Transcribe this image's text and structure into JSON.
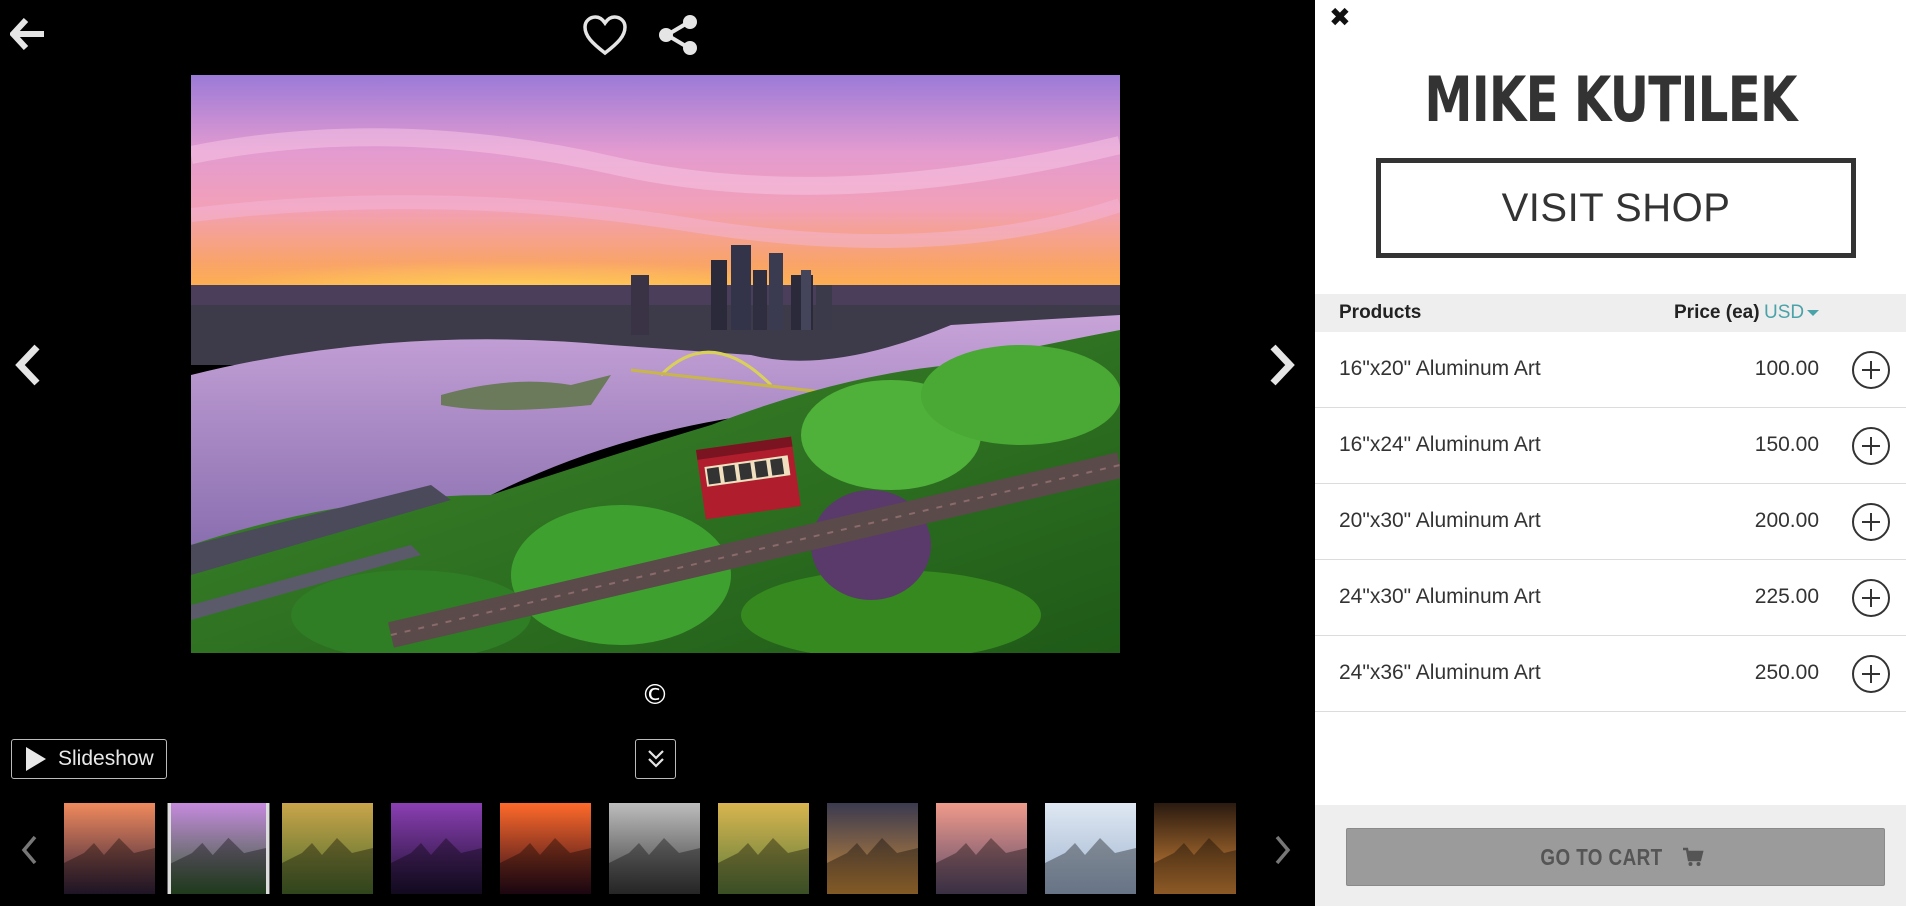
{
  "viewer": {
    "icons": {
      "back": "arrow-left-icon",
      "favorite": "heart-outline-icon",
      "share": "share-icon",
      "prev": "chevron-left-icon",
      "next": "chevron-right-icon",
      "collapse": "double-chevron-down-icon",
      "play": "play-icon"
    },
    "copyright_symbol": "©",
    "slideshow_label": "Slideshow",
    "selected_thumbnail_index": 1,
    "thumbnails": [
      {
        "name": "thumb-sunset-skyline",
        "top": "#f08a5d",
        "bottom": "#30203a"
      },
      {
        "name": "thumb-incline-sunrise",
        "top": "#c88be0",
        "bottom": "#2f5a2a"
      },
      {
        "name": "thumb-autumn-park",
        "top": "#c9a54a",
        "bottom": "#4a6b2c"
      },
      {
        "name": "thumb-bridge-purple",
        "top": "#8b3fb3",
        "bottom": "#1c1030"
      },
      {
        "name": "thumb-fiery-skyline",
        "top": "#ff6a2a",
        "bottom": "#2a0a1a"
      },
      {
        "name": "thumb-bw-reflection",
        "top": "#bdbdbd",
        "bottom": "#3a3a3a"
      },
      {
        "name": "thumb-fall-incline",
        "top": "#d9b54f",
        "bottom": "#5a7a3a"
      },
      {
        "name": "thumb-night-city",
        "top": "#3a3a50",
        "bottom": "#c98a3a"
      },
      {
        "name": "thumb-foggy-pink",
        "top": "#f09a8a",
        "bottom": "#5a4a6a"
      },
      {
        "name": "thumb-misty-blue",
        "top": "#dfe8f3",
        "bottom": "#9fb3cf"
      },
      {
        "name": "thumb-fireworks",
        "top": "#2a1a10",
        "bottom": "#d98a3a"
      }
    ]
  },
  "panel": {
    "artist_name": "MIKE KUTILEK",
    "visit_shop_label": "VISIT SHOP",
    "close_icon": "close-icon",
    "header": {
      "products": "Products",
      "price": "Price (ea)",
      "currency": "USD"
    },
    "products": [
      {
        "name": "16\"x20\" Aluminum Art",
        "price": "100.00"
      },
      {
        "name": "16\"x24\" Aluminum Art",
        "price": "150.00"
      },
      {
        "name": "20\"x30\" Aluminum Art",
        "price": "200.00"
      },
      {
        "name": "24\"x30\" Aluminum Art",
        "price": "225.00"
      },
      {
        "name": "24\"x36\" Aluminum Art",
        "price": "250.00"
      }
    ],
    "go_to_cart_label": "GO TO CART",
    "cart_icon": "shopping-cart-icon",
    "accent_color": "#4aa3a8"
  }
}
